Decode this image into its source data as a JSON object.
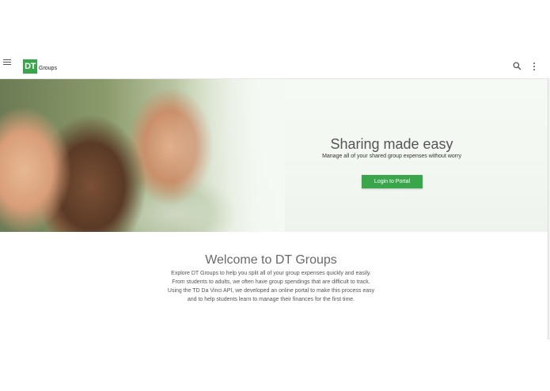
{
  "header": {
    "logo_mark": "DT",
    "logo_text": "Groups",
    "icons": [
      "menu-icon",
      "search-icon",
      "more-vert-icon"
    ]
  },
  "hero": {
    "title": "Sharing made easy",
    "subtitle": "Manage all of your shared group expenses without worry",
    "login_label": "Login to Portal"
  },
  "welcome": {
    "title": "Welcome to DT Groups",
    "lines": [
      "Explore DT Groups to help you split all of your group expenses quickly and easily.",
      "From students to adults, we often have group spendings that are difficult to track.",
      "Using the TD Da Vinci API, we developed an online portal to make this process easy",
      "and to help students learn to manage their finances for the first time."
    ]
  },
  "colors": {
    "accent": "#3aa64b",
    "text": "#555555"
  }
}
